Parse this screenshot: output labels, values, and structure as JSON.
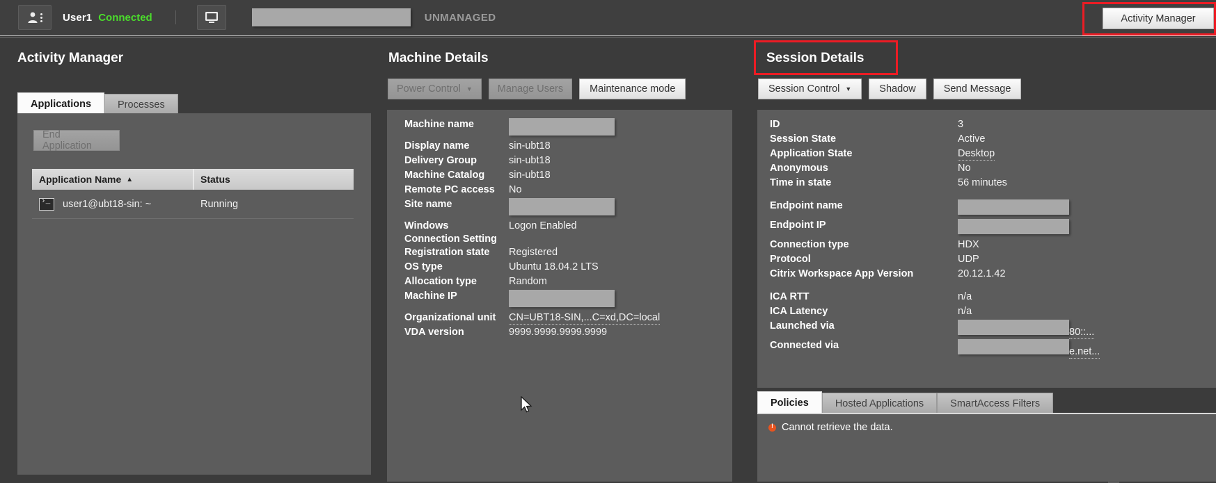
{
  "topbar": {
    "user_name": "User1",
    "connection_status": "Connected",
    "unmanaged_label": "UNMANAGED",
    "activity_manager_button": "Activity Manager",
    "user_icon": "user-card-icon",
    "monitor_icon": "monitor-icon",
    "status_color": "#4bdb2c",
    "highlight_color": "#ec1c24"
  },
  "activity_manager": {
    "title": "Activity Manager",
    "tabs": [
      {
        "label": "Applications",
        "active": true
      },
      {
        "label": "Processes",
        "active": false
      }
    ],
    "end_application_button": "End Application",
    "table": {
      "columns": [
        "Application Name",
        "Status"
      ],
      "sort_indicator": "▲",
      "rows": [
        {
          "icon": "terminal-icon",
          "name": "user1@ubt18-sin: ~",
          "status": "Running"
        }
      ]
    }
  },
  "machine_details": {
    "title": "Machine Details",
    "buttons": [
      {
        "label": "Power Control",
        "has_caret": true,
        "caret": "▼"
      },
      {
        "label": "Manage Users",
        "has_caret": false
      },
      {
        "label": "Maintenance mode",
        "has_caret": false
      }
    ],
    "rows": [
      {
        "label": "Machine name",
        "value": "",
        "redacted": true
      },
      {
        "label": "Display name",
        "value": "sin-ubt18"
      },
      {
        "label": "Delivery Group",
        "value": "sin-ubt18"
      },
      {
        "label": "Machine Catalog",
        "value": "sin-ubt18"
      },
      {
        "label": "Remote PC access",
        "value": "No"
      },
      {
        "label": "Site name",
        "value": "",
        "redacted": true
      },
      {
        "label": "Windows Connection Setting",
        "value": "Logon Enabled"
      },
      {
        "label": "Registration state",
        "value": "Registered"
      },
      {
        "label": "OS type",
        "value": "Ubuntu 18.04.2 LTS"
      },
      {
        "label": "Allocation type",
        "value": "Random"
      },
      {
        "label": "Machine IP",
        "value": "",
        "redacted": true
      },
      {
        "label": "Organizational unit",
        "value": "CN=UBT18-SIN,...C=xd,DC=local",
        "link": true
      },
      {
        "label": "VDA version",
        "value": "9999.9999.9999.9999"
      }
    ]
  },
  "session_details": {
    "title": "Session Details",
    "buttons": [
      {
        "label": "Session Control",
        "has_caret": true,
        "caret": "▼"
      },
      {
        "label": "Shadow",
        "has_caret": false
      },
      {
        "label": "Send Message",
        "has_caret": false
      }
    ],
    "rows": [
      {
        "label": "ID",
        "value": "3"
      },
      {
        "label": "Session State",
        "value": "Active"
      },
      {
        "label": "Application State",
        "value": "Desktop",
        "link": true
      },
      {
        "label": "Anonymous",
        "value": "No"
      },
      {
        "label": "Time in state",
        "value": "56 minutes"
      },
      {
        "spacer": true
      },
      {
        "label": "Endpoint name",
        "value": "",
        "redacted": true
      },
      {
        "label": "Endpoint IP",
        "value": "",
        "redacted": true
      },
      {
        "label": "Connection type",
        "value": "HDX"
      },
      {
        "label": "Protocol",
        "value": "UDP"
      },
      {
        "label": "Citrix Workspace App Version",
        "value": "20.12.1.42"
      },
      {
        "spacer": true
      },
      {
        "label": "ICA RTT",
        "value": "n/a"
      },
      {
        "label": "ICA Latency",
        "value": "n/a"
      },
      {
        "label": "Launched via",
        "value": "",
        "redacted": true,
        "trailing": "80::..."
      },
      {
        "label": "Connected via",
        "value": "",
        "redacted": true,
        "trailing": "e.net..."
      }
    ],
    "tabs": [
      {
        "label": "Policies",
        "active": true
      },
      {
        "label": "Hosted Applications",
        "active": false
      },
      {
        "label": "SmartAccess Filters",
        "active": false
      }
    ],
    "error_message": "Cannot retrieve the data.",
    "error_icon": "error-badge-icon"
  },
  "scrollbars": {
    "up_arrow": "▲",
    "down_arrow": "▼"
  }
}
